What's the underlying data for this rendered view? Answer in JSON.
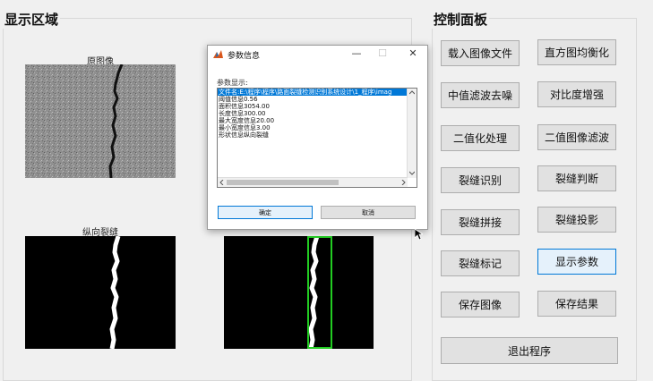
{
  "display_area": {
    "title": "显示区域"
  },
  "control_panel": {
    "title": "控制面板",
    "buttons": [
      "载入图像文件",
      "直方图均衡化",
      "中值滤波去噪",
      "对比度增强",
      "二值化处理",
      "二值图像滤波",
      "裂缝识别",
      "裂缝判断",
      "裂缝拼接",
      "裂缝投影",
      "裂缝标记",
      "显示参数",
      "保存图像",
      "保存结果"
    ],
    "exit_label": "退出程序",
    "active_button": "显示参数"
  },
  "images": {
    "original_caption": "原图像",
    "longitudinal_caption": "纵向裂缝"
  },
  "dialog": {
    "title": "参数信息",
    "minimize": "—",
    "maximize": "☐",
    "close": "✕",
    "label": "参数显示:",
    "lines": [
      "文件名:E:\\程序\\程序\\路面裂缝检测识别系统设计\\1_程序\\imag",
      "阈值信息0.56",
      "面积信息3054.00",
      "长度信息300.00",
      "最大宽度信息20.00",
      "最小宽度信息3.00",
      "形状信息纵向裂缝"
    ],
    "ok_label": "确定",
    "cancel_label": "取消"
  },
  "colors": {
    "accent": "#0078d7",
    "marker_box": "#22cc22"
  }
}
